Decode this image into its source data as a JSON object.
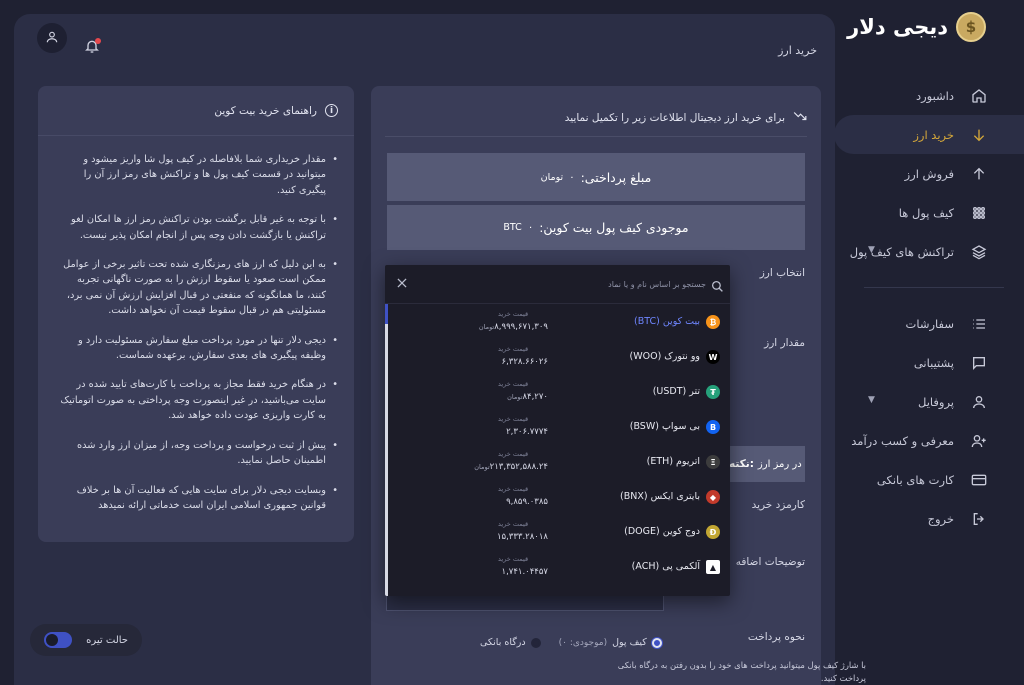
{
  "brand": {
    "name": "دیجی دلار",
    "coin_glyph": "$",
    "colors": {
      "gold": "#d4a73a",
      "accent": "#3f51c4"
    }
  },
  "header": {
    "page_title": "خرید ارز"
  },
  "sidebar": {
    "items": [
      {
        "label": "داشبورد",
        "icon": "home-icon"
      },
      {
        "label": "خرید ارز",
        "icon": "arrow-down-icon",
        "active": true
      },
      {
        "label": "فروش ارز",
        "icon": "arrow-up-icon"
      },
      {
        "label": "کیف پول ها",
        "icon": "grid-icon"
      },
      {
        "label": "تراکنش های کیف پول",
        "icon": "layers-icon",
        "expandable": true
      }
    ],
    "items2": [
      {
        "label": "سفارشات",
        "icon": "list-icon"
      },
      {
        "label": "پشتیبانی",
        "icon": "chat-icon"
      },
      {
        "label": "پروفایل",
        "icon": "user-icon",
        "expandable": true
      },
      {
        "label": "معرفی و کسب درآمد",
        "icon": "user-plus-icon"
      },
      {
        "label": "کارت های بانکی",
        "icon": "card-icon"
      },
      {
        "label": "خروج",
        "icon": "logout-icon"
      }
    ]
  },
  "guide": {
    "title": "راهنمای خرید بیت کوین",
    "items": [
      "مقدار خریداری شما بلافاصله در کیف پول شا واریز میشود و میتوانید در قسمت کیف پول ها و تراکنش های رمز ارز آن را پیگیری کنید.",
      "با توجه به غیر قابل برگشت بودن تراکنش رمز ارز ها امکان لغو تراکنش یا بازگشت دادن وجه پس از انجام امکان پذیر نیست.",
      "به این دلیل که ارز های رمزنگاری شده تحت تاثیر برخی از عوامل ممکن است صعود یا سقوط ارزش را به صورت ناگهانی تجربه کنند، ما همانگونه که منفعتی در قبال افزایش ارزش آن نمی برد، مسئولیتی هم در قبال سقوط قیمت آن نخواهد داشت.",
      "دیجی دلار تنها در مورد پرداخت مبلغ سفارش مسئولیت دارد و وظیفه پیگیری های بعدی سفارش، برعهده شماست.",
      "در هنگام خرید فقط مجاز به پرداخت با کارت‌های تایید شده در سایت می‌باشید، در غیر اینصورت وجه پرداختی به صورت اتوماتیک به کارت واریزی عودت داده خواهد شد.",
      "پیش از ثبت درخواست و پرداخت وجه، از میزان ارز وارد شده اطمینان حاصل نمایید.",
      "وبسایت دیجی دلار برای سایت هایی که فعالیت آن ها بر خلاف قوانین جمهوری اسلامی ایران است خدماتی ارائه نمیدهد"
    ]
  },
  "theme_toggle": {
    "label": "حالت تیره"
  },
  "form": {
    "intro": "برای خرید ارز دیجیتال اطلاعات زیر را تکمیل نمایید",
    "pay_amount_label": "مبلغ پرداختی:",
    "pay_amount_value": "۰",
    "pay_amount_unit": "تومان",
    "wallet_label": "موجودی کیف پول بیت کوین:",
    "wallet_value": "۰",
    "wallet_unit": "BTC",
    "select_currency_label": "انتخاب ارز",
    "amount_label": "مقدار ارز",
    "note_bold": "نکته:",
    "note_text": "در رمز ارز",
    "fee_label": "کارمزد خرید",
    "extra_desc_label": "توضیحات اضافه",
    "payment_method_label": "نحوه پرداخت",
    "payment_options": [
      {
        "label": "کیف پول",
        "sub": "(موجودی: ۰)",
        "selected": true
      },
      {
        "label": "درگاه بانکی",
        "sub": "",
        "selected": false
      }
    ],
    "payment_hint": "با شارژ کیف پول میتوانید پرداخت های خود را بدون رفتن به درگاه بانکی پرداخت کنید."
  },
  "dropdown": {
    "search_placeholder": "جستجو بر اساس نام و یا نماد",
    "price_label": "قیمت خرید",
    "coins": [
      {
        "name": "بیت کوین (BTC)",
        "price": "۸,۹۹۹,۶۷۱,۳۰۹",
        "unit": "تومان",
        "color": "#f7931a",
        "glyph": "₿",
        "selected": true,
        "dim": false
      },
      {
        "name": "وو نتورک (WOO)",
        "price": "۶,۳۲۸.۶۶۰۲۶",
        "unit": "",
        "color": "#000000",
        "glyph": "W",
        "selected": false,
        "dim": false
      },
      {
        "name": "تتر (USDT)",
        "price": "۸۴,۲۷۰",
        "unit": "تومان",
        "color": "#26a17b",
        "glyph": "₮",
        "selected": false,
        "dim": false
      },
      {
        "name": "بی سواپ (BSW)",
        "price": "۲,۳۰۶.۷۷۷۴",
        "unit": "",
        "color": "#1263f1",
        "glyph": "B",
        "selected": false,
        "dim": false
      },
      {
        "name": "اتریوم (ETH)",
        "price": "۲۱۳,۳۵۲,۵۸۸.۲۴",
        "unit": "تومان",
        "color": "#3c3c3d",
        "glyph": "Ξ",
        "selected": false,
        "dim": false
      },
      {
        "name": "بایتری ایکس (BNX)",
        "price": "۹,۸۵۹.۰۳۸۵",
        "unit": "",
        "color": "#c23a2b",
        "glyph": "◆",
        "selected": false,
        "dim": false
      },
      {
        "name": "دوج کوین (DOGE)",
        "price": "۱۵,۳۳۳.۲۸۰۱۸",
        "unit": "",
        "color": "#c2a633",
        "glyph": "Ð",
        "selected": false,
        "dim": false
      },
      {
        "name": "آلکمی پی (ACH)",
        "price": "۱,۷۴۱.۰۴۴۵۷",
        "unit": "",
        "color": "#ffffff",
        "glyph": "▲",
        "selected": false,
        "dim": false
      }
    ]
  }
}
